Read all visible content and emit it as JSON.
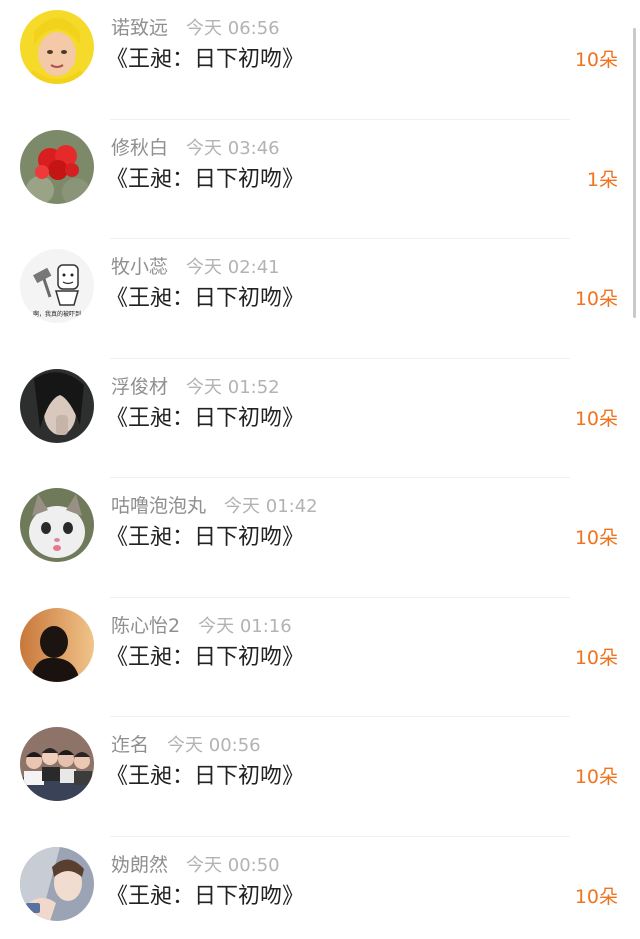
{
  "items": [
    {
      "name": "诺致远",
      "time": "今天 06:56",
      "title": "《王昶：日下初吻》",
      "count": "10朵"
    },
    {
      "name": "修秋白",
      "time": "今天 03:46",
      "title": "《王昶：日下初吻》",
      "count": "1朵"
    },
    {
      "name": "牧小蕊",
      "time": "今天 02:41",
      "title": "《王昶：日下初吻》",
      "count": "10朵"
    },
    {
      "name": "浮俊材",
      "time": "今天 01:52",
      "title": "《王昶：日下初吻》",
      "count": "10朵"
    },
    {
      "name": "咕噜泡泡丸",
      "time": "今天 01:42",
      "title": "《王昶：日下初吻》",
      "count": "10朵"
    },
    {
      "name": "陈心怡2",
      "time": "今天 01:16",
      "title": "《王昶：日下初吻》",
      "count": "10朵"
    },
    {
      "name": "迮名",
      "time": "今天 00:56",
      "title": "《王昶：日下初吻》",
      "count": "10朵"
    },
    {
      "name": "妫朗然",
      "time": "今天 00:50",
      "title": "《王昶：日下初吻》",
      "count": "10朵"
    }
  ],
  "colors": {
    "accent": "#f0731e",
    "name_text": "#8f8f8f",
    "time_text": "#b3b3b3",
    "title_text": "#222222",
    "divider": "#f0f0f0"
  },
  "avatar_stamp_text": "啊，我真的被吓到"
}
